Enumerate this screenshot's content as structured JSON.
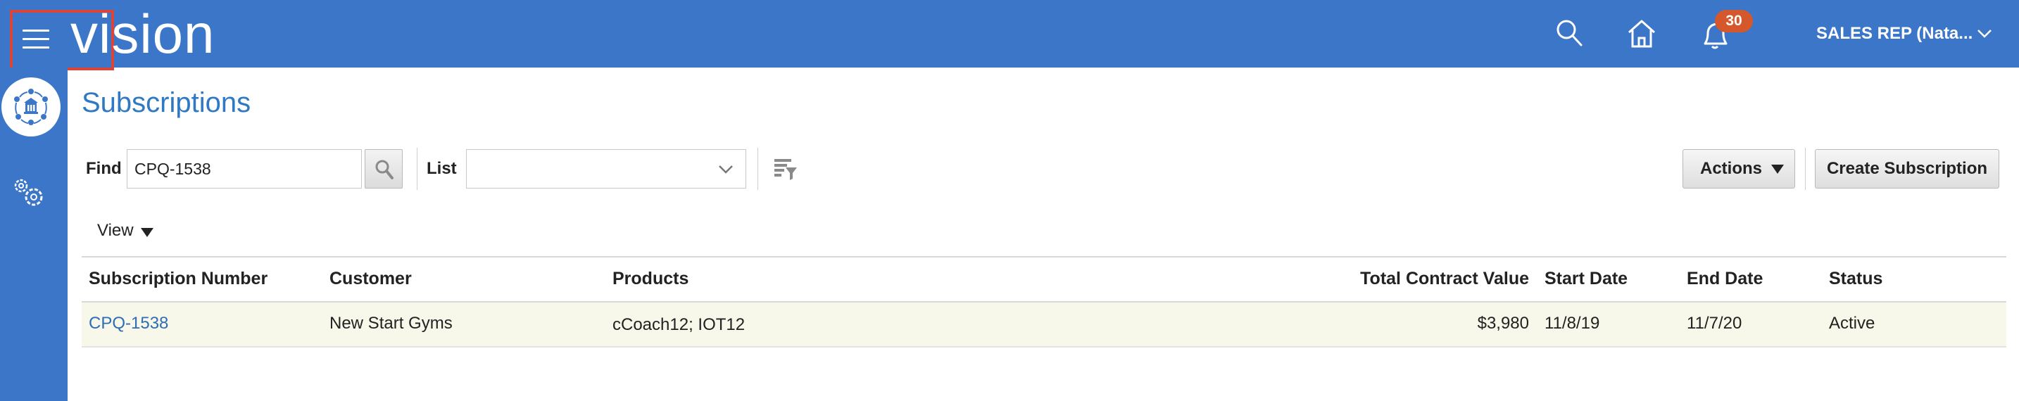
{
  "header": {
    "logo_text": "vision",
    "notification_count": "30",
    "user_label": "SALES REP (Nata...",
    "brand_color": "#3b76c9",
    "badge_color": "#d4582b",
    "icons": [
      "menu-icon",
      "search-icon",
      "home-icon",
      "notifications-icon",
      "chevron-down-icon"
    ]
  },
  "rail": {
    "icons": [
      "work-area-icon",
      "settings-gears-icon"
    ]
  },
  "page": {
    "title": "Subscriptions"
  },
  "search": {
    "find_label": "Find",
    "find_value": "CPQ-1538",
    "list_label": "List",
    "list_value": ""
  },
  "toolbar": {
    "actions_label": "Actions",
    "create_label": "Create Subscription",
    "view_label": "View"
  },
  "table": {
    "columns": [
      "Subscription Number",
      "Customer",
      "Products",
      "Total Contract Value",
      "Start Date",
      "End Date",
      "Status"
    ],
    "rows": [
      {
        "subscription_number": "CPQ-1538",
        "customer": "New Start Gyms",
        "products": "cCoach12; IOT12",
        "total_contract_value": "$3,980",
        "start_date": "11/8/19",
        "end_date": "11/7/20",
        "status": "Active"
      }
    ]
  }
}
